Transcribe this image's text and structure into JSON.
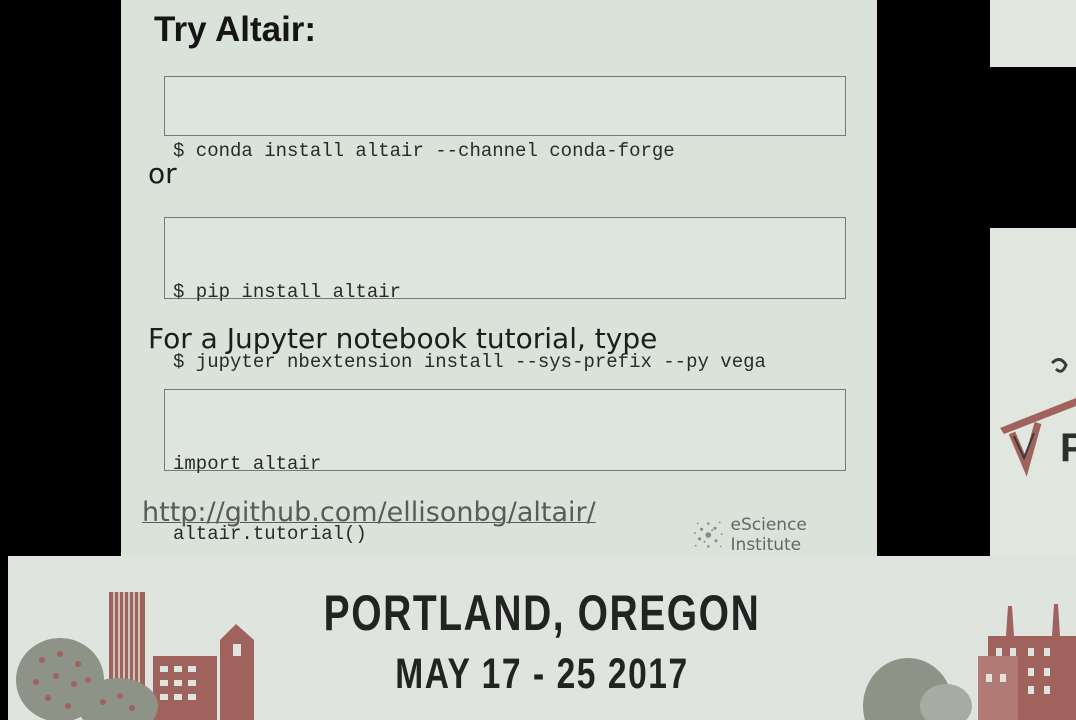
{
  "slide": {
    "title": "Try Altair:",
    "conda_command": "$ conda install altair --channel conda-forge",
    "or_text": "or",
    "pip_commands": [
      "$ pip install altair",
      "$ jupyter nbextension install --sys-prefix --py vega"
    ],
    "tutorial_text": "For a Jupyter notebook tutorial, type",
    "tutorial_code": [
      "import altair",
      "altair.tutorial()"
    ],
    "link": "http://github.com/ellisonbg/altair/",
    "logo_text": "eScience Institute"
  },
  "thumbnail": {
    "letter": "P"
  },
  "banner": {
    "location": "PORTLAND, OREGON",
    "dates": "MAY 17 - 25 2017"
  },
  "colors": {
    "slide_bg": "#d9e3da",
    "banner_bg": "#dfe4df",
    "building_red": "#a0625c",
    "tree_gray": "#8e9388"
  }
}
